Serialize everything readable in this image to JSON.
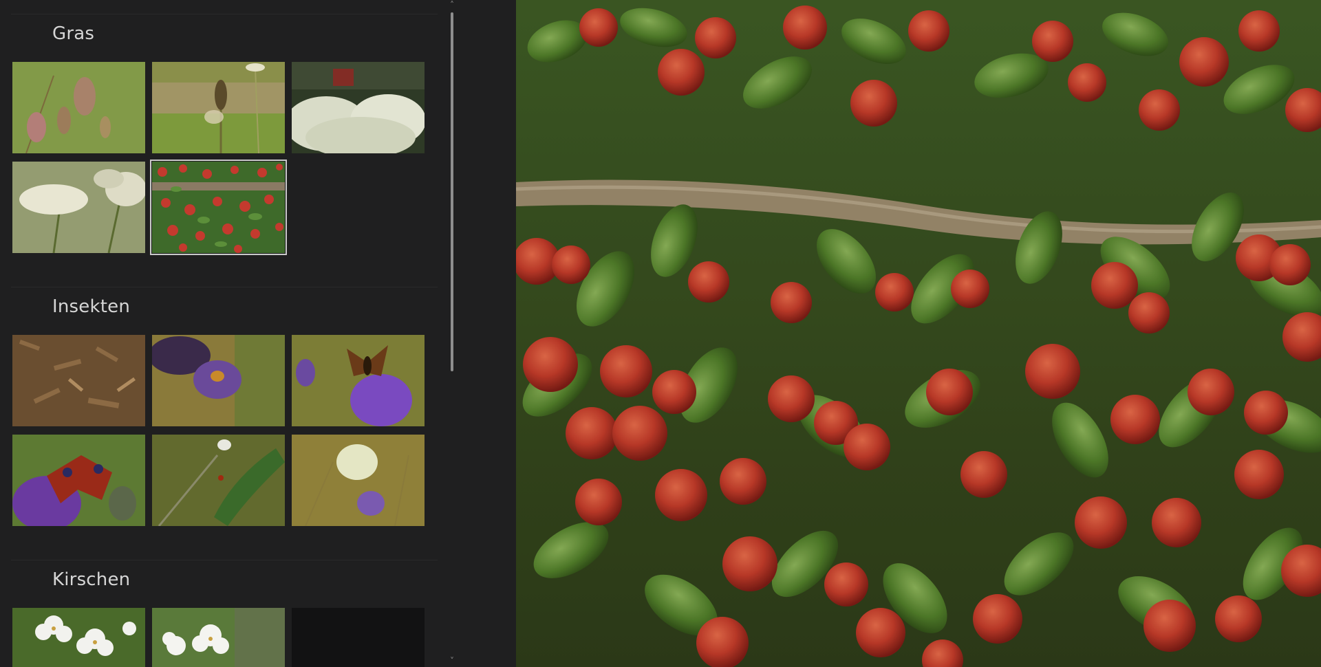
{
  "sidebar": {
    "sections": [
      {
        "title": "Gras",
        "photos": [
          {
            "name": "photo-gras-1",
            "theme": "grass-seedheads"
          },
          {
            "name": "photo-gras-2",
            "theme": "plantain-flower"
          },
          {
            "name": "photo-gras-3",
            "theme": "white-umbels"
          },
          {
            "name": "photo-gras-4",
            "theme": "cow-parsley"
          },
          {
            "name": "photo-gras-5",
            "theme": "red-berries",
            "selected": true
          }
        ]
      },
      {
        "title": "Insekten",
        "photos": [
          {
            "name": "photo-insekten-1",
            "theme": "wood-chips"
          },
          {
            "name": "photo-insekten-2",
            "theme": "bee-on-buddleia"
          },
          {
            "name": "photo-insekten-3",
            "theme": "butterfly-on-buddleia"
          },
          {
            "name": "photo-insekten-4",
            "theme": "peacock-butterfly"
          },
          {
            "name": "photo-insekten-5",
            "theme": "ladybird-leaf"
          },
          {
            "name": "photo-insekten-6",
            "theme": "white-butterfly"
          }
        ]
      },
      {
        "title": "Kirschen",
        "photos": [
          {
            "name": "photo-kirschen-1",
            "theme": "cherry-blossom"
          },
          {
            "name": "photo-kirschen-2",
            "theme": "cherry-blossom-2"
          },
          {
            "name": "photo-kirschen-3",
            "theme": "empty"
          }
        ]
      }
    ]
  },
  "scrollbar": {
    "up_icon": "chevron-up-icon",
    "down_icon": "chevron-down-icon"
  },
  "viewer": {
    "subject": "cotoneaster red berries with green leaves"
  },
  "colors": {
    "background": "#1f1f20",
    "title_text": "#d6d6d6",
    "selection_outline": "#c9c9c9",
    "scroll_thumb": "#8e8e8e"
  }
}
